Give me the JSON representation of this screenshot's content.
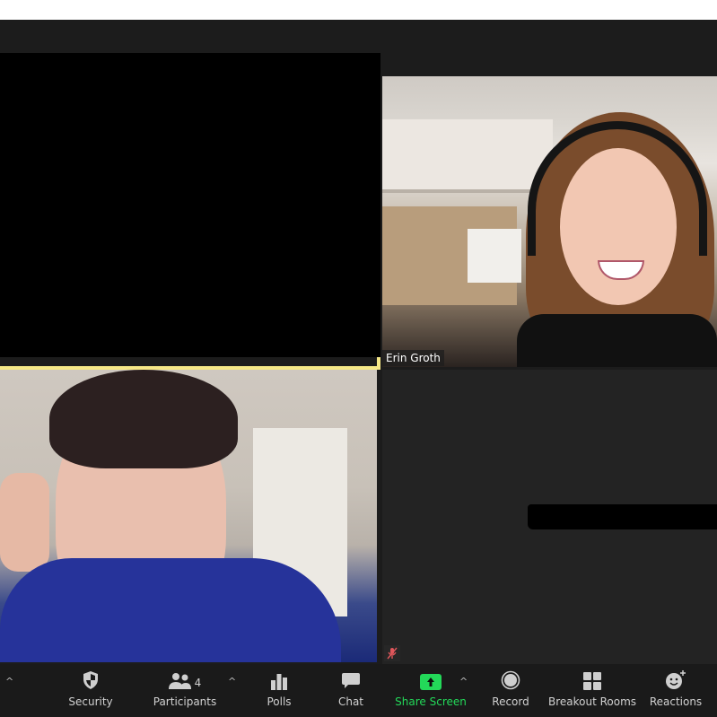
{
  "participants": [
    {
      "tile": "top-left",
      "video": "off",
      "name": ""
    },
    {
      "tile": "top-right",
      "video": "on",
      "name": "Erin Groth"
    },
    {
      "tile": "bottom-left",
      "video": "on",
      "name": "",
      "active_speaker": true
    },
    {
      "tile": "bottom-right",
      "video": "off",
      "name": "[redacted]",
      "muted": true
    }
  ],
  "toolbar": {
    "items": [
      {
        "id": "security",
        "label": "Security",
        "icon": "shield-icon"
      },
      {
        "id": "participants",
        "label": "Participants",
        "icon": "participants-icon",
        "count": "4"
      },
      {
        "id": "polls",
        "label": "Polls",
        "icon": "polls-icon"
      },
      {
        "id": "chat",
        "label": "Chat",
        "icon": "chat-icon"
      },
      {
        "id": "share-screen",
        "label": "Share Screen",
        "icon": "share-screen-icon"
      },
      {
        "id": "record",
        "label": "Record",
        "icon": "record-icon"
      },
      {
        "id": "breakout-rooms",
        "label": "Breakout Rooms",
        "icon": "breakout-rooms-icon"
      },
      {
        "id": "reactions",
        "label": "Reactions",
        "icon": "reactions-icon"
      }
    ],
    "caret": "^"
  },
  "colors": {
    "active_speaker": "#f6e887",
    "share_screen": "#23d959",
    "muted": "#e0565b"
  }
}
